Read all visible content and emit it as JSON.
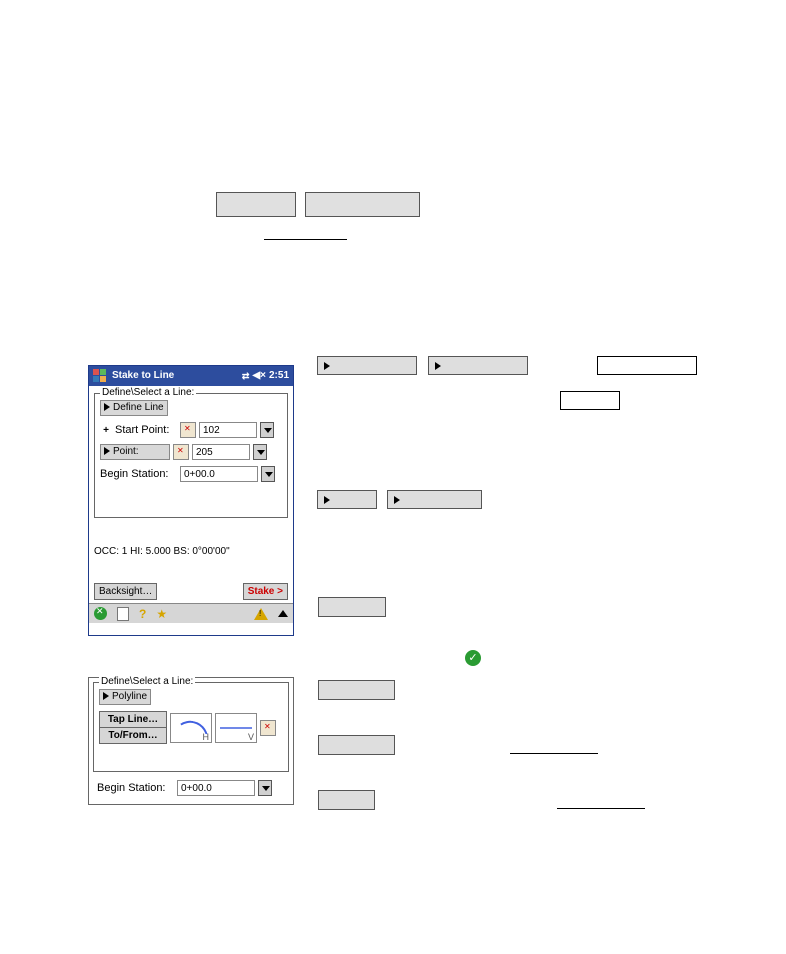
{
  "pda1": {
    "title": "Stake to Line",
    "time": "2:51",
    "section_label": "Define\\Select a Line:",
    "define_line_label": "Define Line",
    "start_point_label": "Start Point:",
    "start_point_value": "102",
    "point_label": "Point:",
    "point_value": "205",
    "begin_station_label": "Begin Station:",
    "begin_station_value": "0+00.0",
    "status": "OCC: 1  HI: 5.000  BS: 0°00'00\"",
    "backsight_btn": "Backsight…",
    "stake_btn": "Stake >"
  },
  "pda2": {
    "section_label": "Define\\Select a Line:",
    "polyline_label": "Polyline",
    "tap_line_btn": "Tap Line…",
    "tofrom_btn": "To/From…",
    "h_label": "H",
    "v_label": "V",
    "begin_station_label": "Begin Station:",
    "begin_station_value": "0+00.0"
  }
}
